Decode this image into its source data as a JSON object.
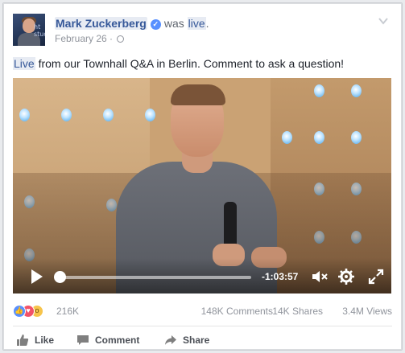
{
  "post": {
    "author": "Mark Zuckerberg",
    "verified_icon": "verified-check-icon",
    "status_prefix": "was",
    "status_link": "live",
    "status_suffix": ".",
    "date": "February 26",
    "meta_separator": "·",
    "privacy_icon": "globe-icon",
    "avatar_overlay_text": "ht stud",
    "text_live": "Live",
    "text_rest": " from our Townhall Q&A in Berlin. Comment to ask a question!"
  },
  "video": {
    "remaining_time": "-1:03:57",
    "progress": 0.0,
    "icons": [
      "play-icon",
      "mute-icon",
      "settings-gear-icon",
      "fullscreen-icon"
    ]
  },
  "stats": {
    "reactions": [
      "like",
      "love",
      "wow"
    ],
    "reaction_count": "216K",
    "comments": "148K Comments",
    "shares": "14K Shares",
    "views": "3.4M Views"
  },
  "actions": {
    "like": "Like",
    "comment": "Comment",
    "share": "Share"
  },
  "colors": {
    "link": "#365899",
    "meta": "#90949c",
    "like_blue": "#5890ff",
    "love_red": "#f25268",
    "wow_yellow": "#f7c44b"
  }
}
